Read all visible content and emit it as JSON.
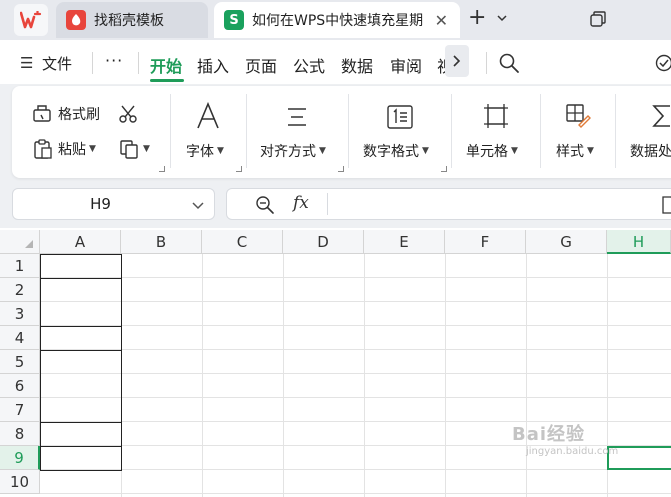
{
  "tabs": [
    {
      "label": "找稻壳模板",
      "icon": "docer-icon"
    },
    {
      "label": "如何在WPS中快速填充星期",
      "icon": "spreadsheet-icon"
    }
  ],
  "menu": {
    "file": "文件",
    "more": "···",
    "items": [
      "开始",
      "插入",
      "页面",
      "公式",
      "数据",
      "审阅",
      "视"
    ]
  },
  "ribbon": {
    "format_painter": "格式刷",
    "paste": "粘贴",
    "font": "字体",
    "align": "对齐方式",
    "number_format": "数字格式",
    "cell": "单元格",
    "style": "样式",
    "data_proc": "数据处"
  },
  "namebox": {
    "value": "H9"
  },
  "formula": {
    "fx": "fx",
    "content": ""
  },
  "columns": [
    "A",
    "B",
    "C",
    "D",
    "E",
    "F",
    "G",
    "H"
  ],
  "rows": [
    "1",
    "2",
    "3",
    "4",
    "5",
    "6",
    "7",
    "8",
    "9",
    "10"
  ],
  "selection": {
    "column": "H",
    "row": "9",
    "accent": "#1f9c59"
  },
  "watermark": {
    "top": "Bai经验",
    "bottom": "jingyan.baidu.com"
  }
}
